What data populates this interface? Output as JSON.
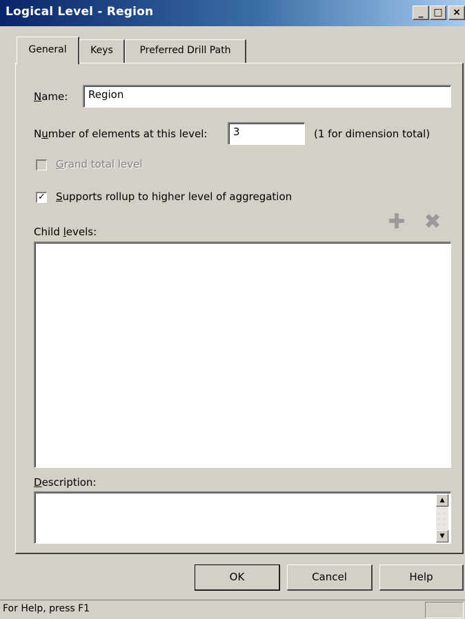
{
  "window": {
    "title": "Logical Level - Region",
    "minimize": "_",
    "maximize": "□",
    "close": "×"
  },
  "tabs": [
    {
      "label": "General"
    },
    {
      "label": "Keys"
    },
    {
      "label": "Preferred Drill Path"
    }
  ],
  "form": {
    "name_label_prefix": "N",
    "name_label_rest": "ame:",
    "name_value": "Region",
    "elements_label_prefix": "N",
    "elements_label_u": "u",
    "elements_label_rest": "mber of elements at this level:",
    "elements_value": "3",
    "elements_hint": "(1 for dimension total)",
    "grand_total_u": "G",
    "grand_total_rest": "rand total level",
    "grand_total_checked": false,
    "rollup_u": "S",
    "rollup_rest": "upports rollup to higher level of aggregation",
    "rollup_checked": true,
    "rollup_mark": "✓",
    "child_levels_prefix": "Child ",
    "child_levels_u": "l",
    "child_levels_rest": "evels:",
    "add_icon": "✚",
    "delete_icon": "✖",
    "description_u": "D",
    "description_rest": "escription:",
    "scroll_up": "▲",
    "scroll_down": "▼"
  },
  "buttons": {
    "ok": "OK",
    "cancel": "Cancel",
    "help": "Help"
  },
  "status": {
    "text": "For Help, press F1"
  }
}
